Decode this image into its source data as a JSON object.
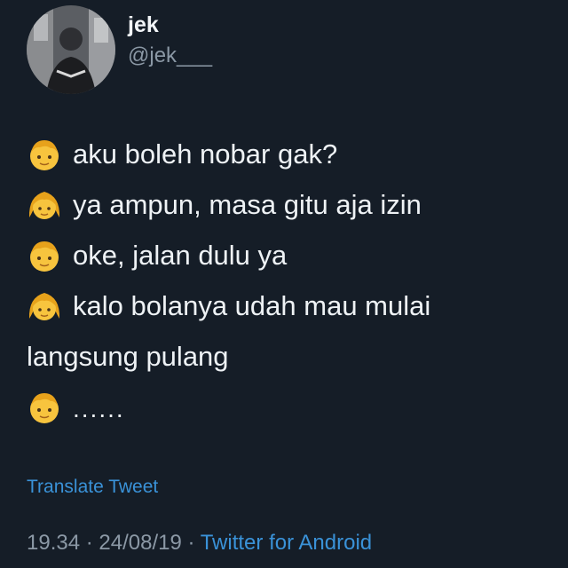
{
  "author": {
    "display_name": "jek",
    "handle": "@jek___"
  },
  "lines": [
    {
      "emoji": "boy",
      "text": "aku boleh nobar gak?"
    },
    {
      "emoji": "girl",
      "text": "ya ampun, masa gitu aja izin"
    },
    {
      "emoji": "boy",
      "text": "oke, jalan dulu ya"
    },
    {
      "emoji": "girl",
      "text": "kalo bolanya udah mau mulai"
    },
    {
      "emoji": "",
      "text": "langsung pulang"
    },
    {
      "emoji": "boy",
      "text": "......"
    }
  ],
  "translate_label": "Translate Tweet",
  "meta": {
    "time": "19.34",
    "separator1": " · ",
    "date": "24/08/19",
    "separator2": " · ",
    "source": "Twitter for Android"
  },
  "colors": {
    "background": "#151d27",
    "link": "#3a92d8",
    "muted": "#8b98a5"
  }
}
